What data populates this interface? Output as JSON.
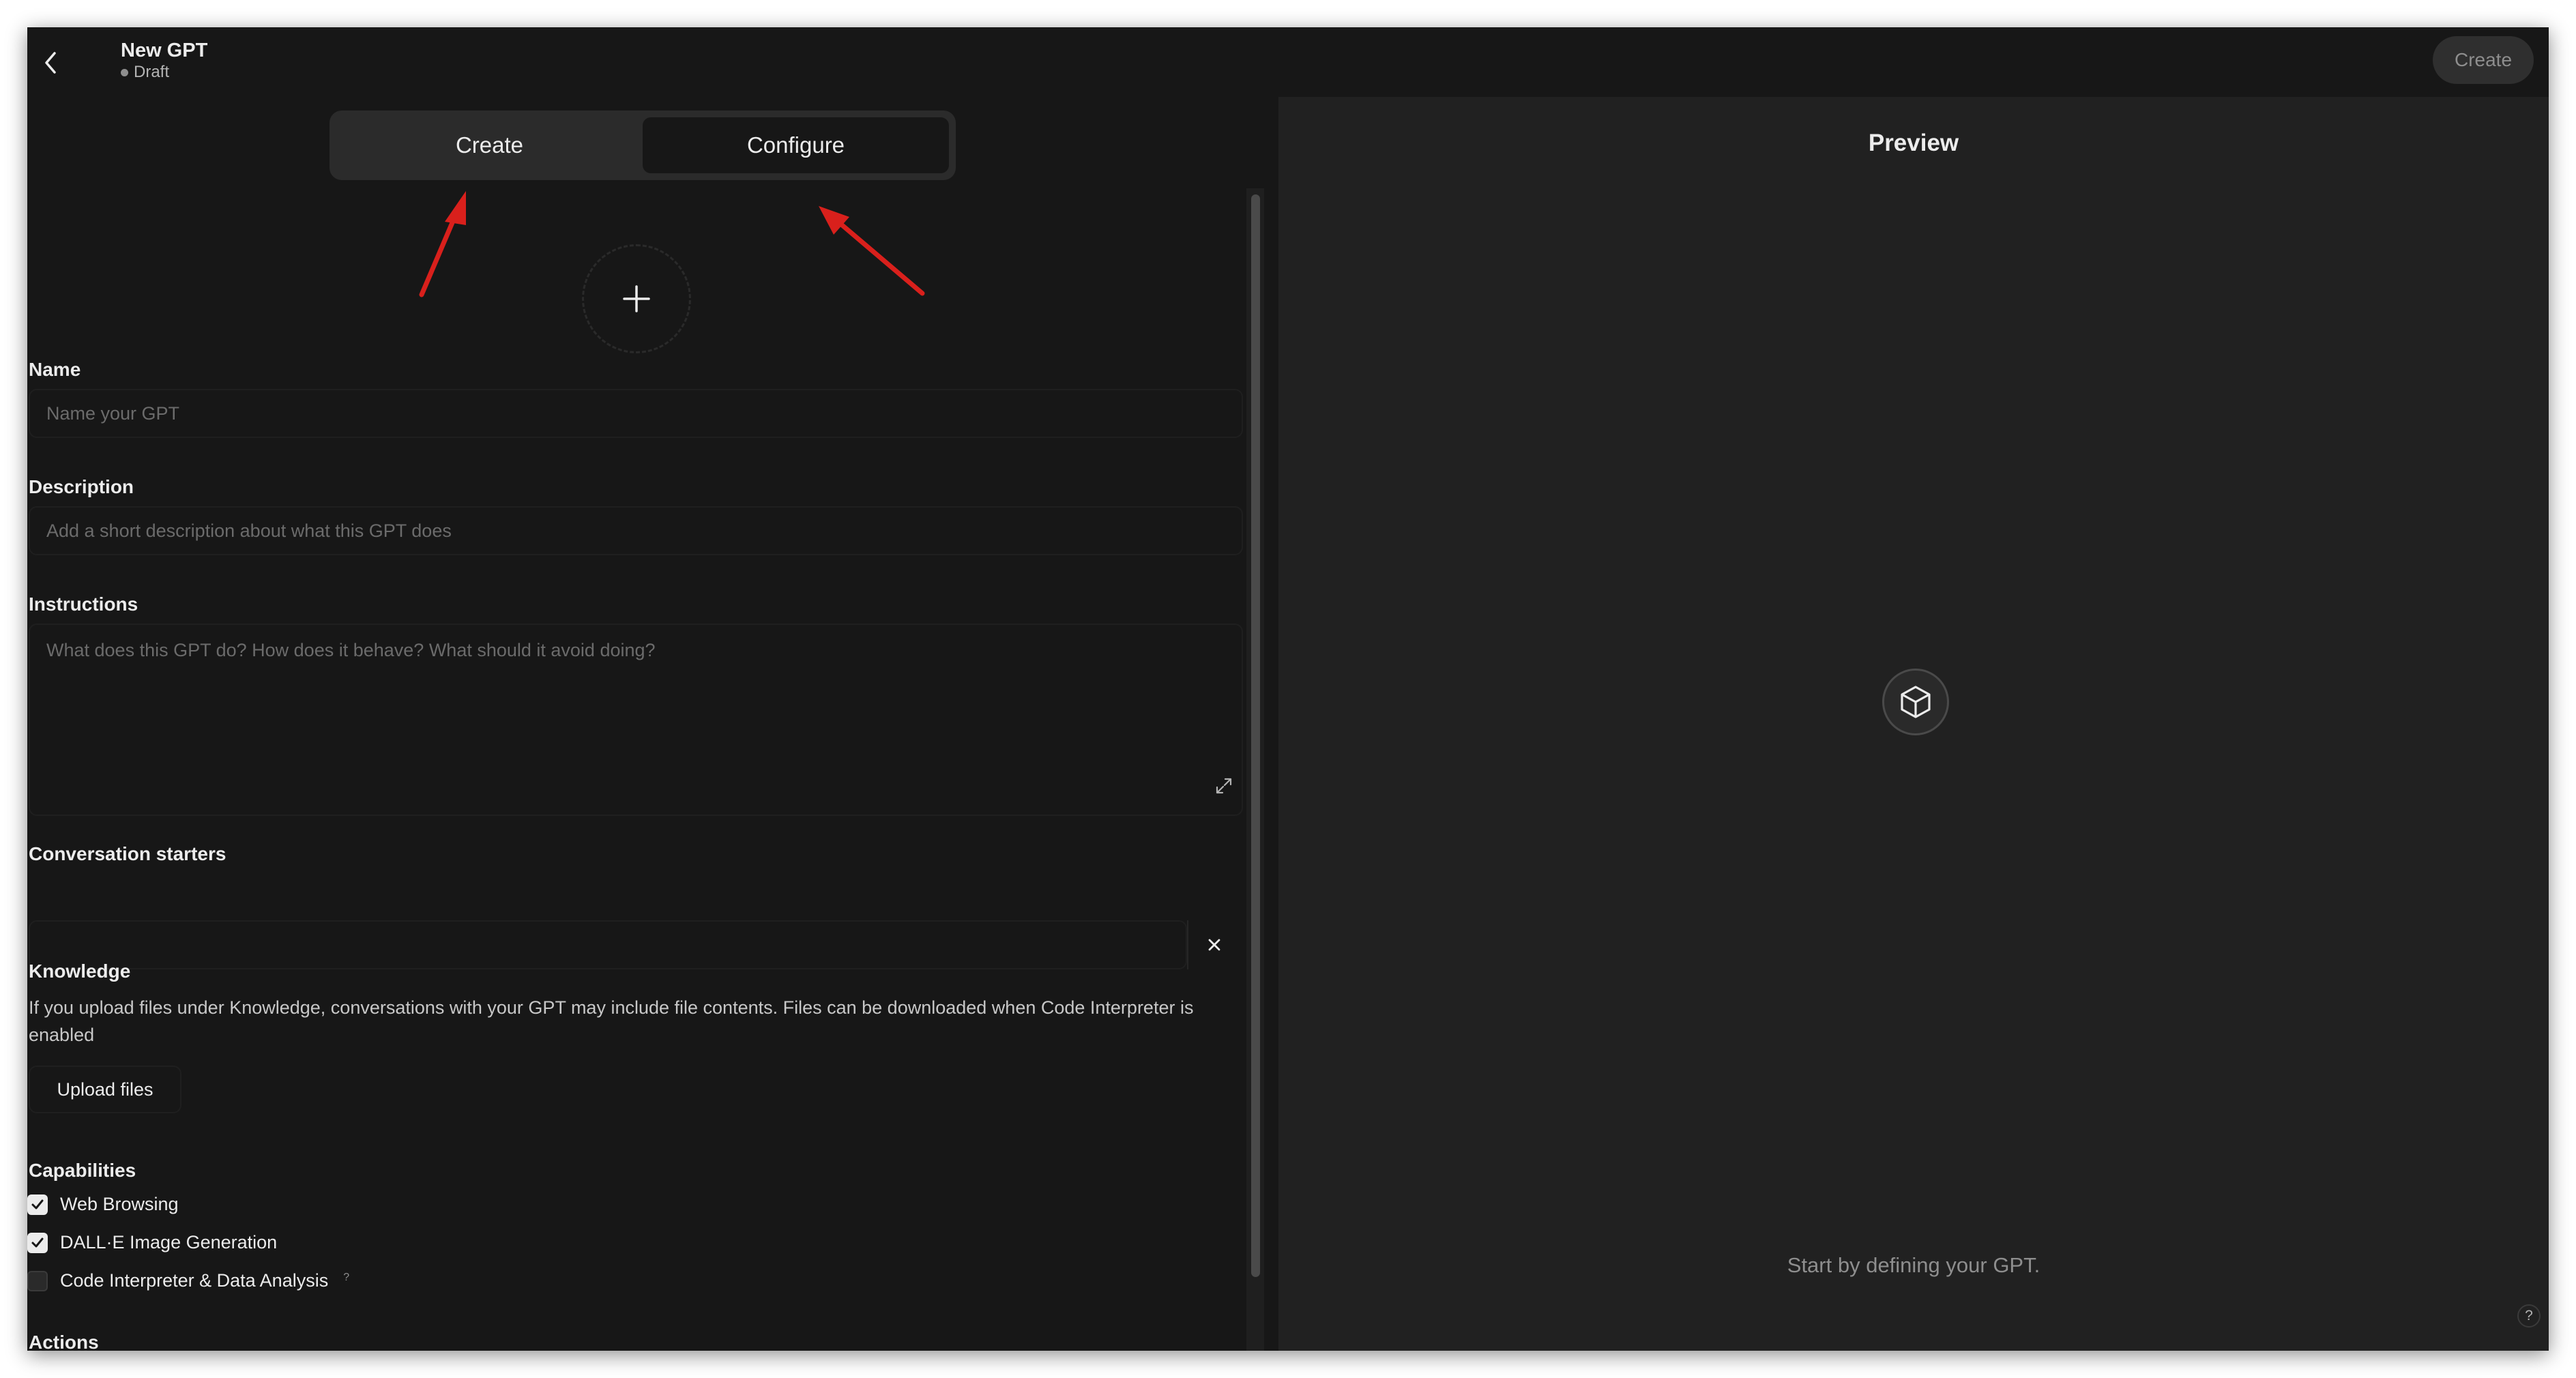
{
  "header": {
    "title": "New GPT",
    "status": "Draft",
    "create_button": "Create"
  },
  "tabs": [
    {
      "label": "Create",
      "active": false
    },
    {
      "label": "Configure",
      "active": true
    }
  ],
  "form": {
    "name": {
      "label": "Name",
      "placeholder": "Name your GPT",
      "value": ""
    },
    "description": {
      "label": "Description",
      "placeholder": "Add a short description about what this GPT does",
      "value": ""
    },
    "instructions": {
      "label": "Instructions",
      "placeholder": "What does this GPT do? How does it behave? What should it avoid doing?",
      "value": ""
    },
    "conversation_starters": {
      "label": "Conversation starters",
      "value": ""
    },
    "knowledge": {
      "label": "Knowledge",
      "note": "If you upload files under Knowledge, conversations with your GPT may include file contents. Files can be downloaded when Code Interpreter is enabled",
      "upload_label": "Upload files"
    },
    "capabilities": {
      "label": "Capabilities",
      "items": [
        {
          "label": "Web Browsing",
          "checked": true
        },
        {
          "label": "DALL·E Image Generation",
          "checked": true
        },
        {
          "label": "Code Interpreter & Data Analysis",
          "checked": false,
          "help": "?"
        }
      ]
    },
    "actions_label": "Actions"
  },
  "preview": {
    "title": "Preview",
    "hint": "Start by defining your GPT.",
    "help": "?"
  },
  "icons": {
    "back": "chevron-left-icon",
    "add": "plus-icon",
    "expand": "expand-icon",
    "remove": "close-icon",
    "gpt": "cube-icon",
    "check": "check-icon"
  },
  "colors": {
    "background": "#212121",
    "sidebar": "#171717",
    "text": "#ececec",
    "muted": "#8e8e8e",
    "annotation_arrow": "#d9201c"
  }
}
